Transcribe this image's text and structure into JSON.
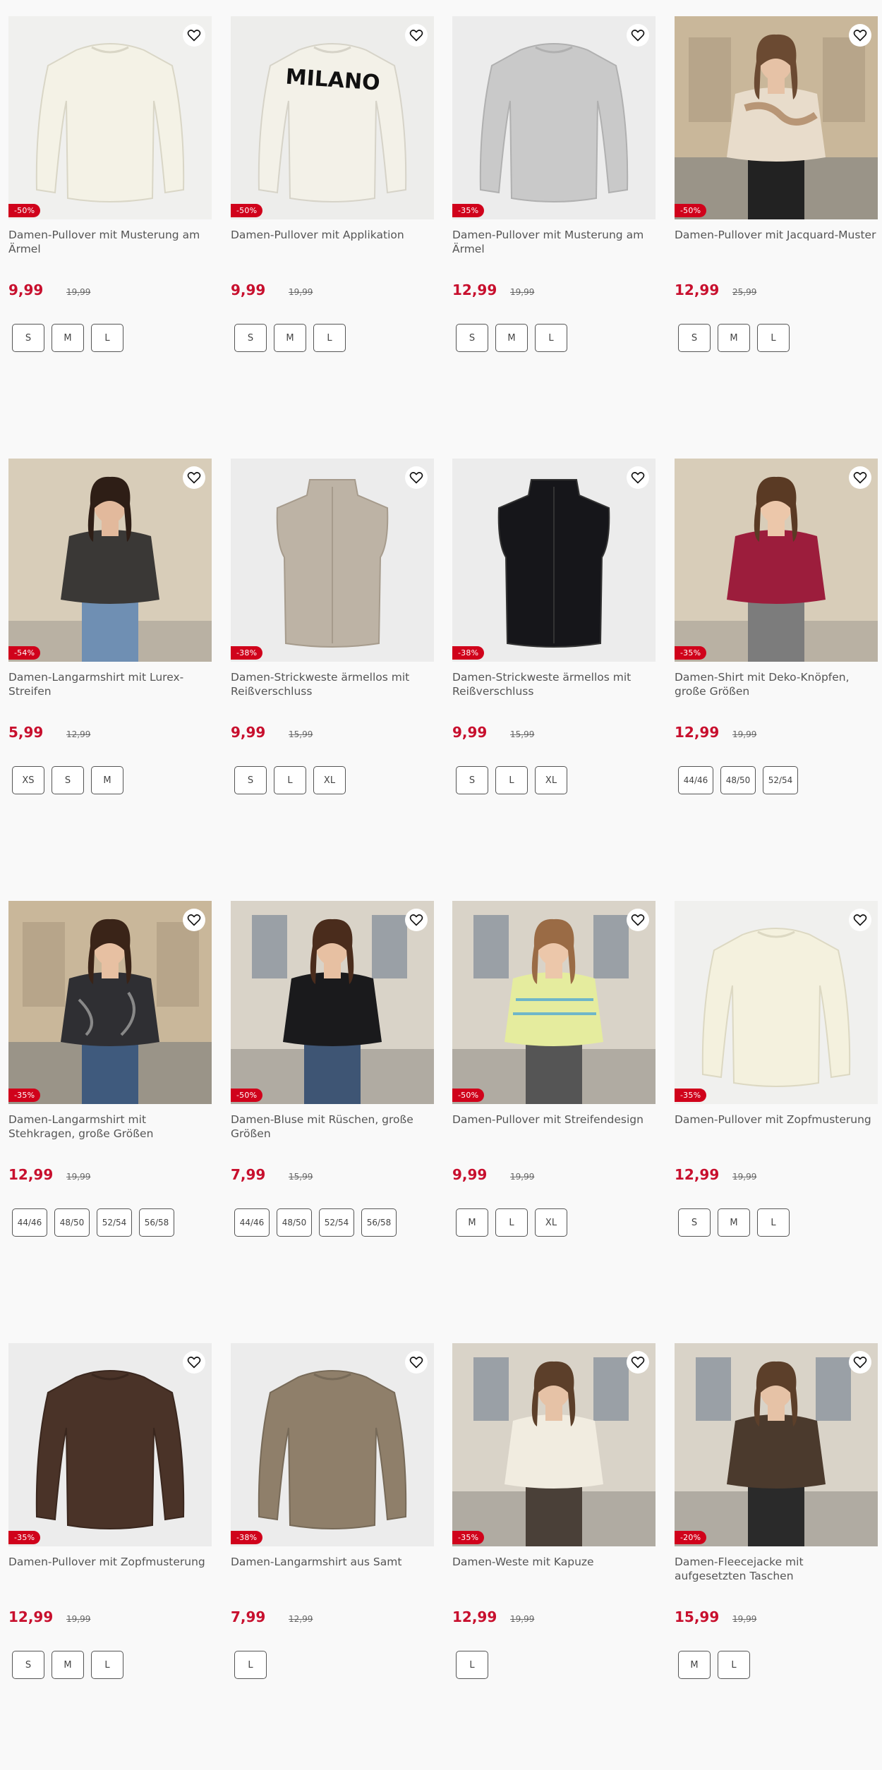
{
  "colors": {
    "price": "#c8102e",
    "badge": "#d0021b",
    "page_bg": "#f9f9f9",
    "image_bg": "#ececec"
  },
  "wishlist_icon": "heart-icon",
  "products": [
    {
      "title": "Damen-Pullover mit Musterung am Ärmel",
      "discount": "-50%",
      "price": "9,99",
      "old_price": "19,99",
      "sizes": [
        "S",
        "M",
        "L"
      ],
      "image": "cream-cable-knit-pullover"
    },
    {
      "title": "Damen-Pullover mit Applikation",
      "discount": "-50%",
      "price": "9,99",
      "old_price": "19,99",
      "sizes": [
        "S",
        "M",
        "L"
      ],
      "image": "white-pullover-milano",
      "image_text": "MILANO"
    },
    {
      "title": "Damen-Pullover mit Musterung am Ärmel",
      "discount": "-35%",
      "price": "12,99",
      "old_price": "19,99",
      "sizes": [
        "S",
        "M",
        "L"
      ],
      "image": "grey-knit-pullover"
    },
    {
      "title": "Damen-Pullover mit Jacquard-Muster",
      "discount": "-50%",
      "price": "12,99",
      "old_price": "25,99",
      "sizes": [
        "S",
        "M",
        "L"
      ],
      "image": "model-beige-jacquard-pullover"
    },
    {
      "title": "Damen-Langarmshirt mit Lurex-Streifen",
      "discount": "-54%",
      "price": "5,99",
      "old_price": "12,99",
      "sizes": [
        "XS",
        "S",
        "M"
      ],
      "image": "model-black-cropped-shirt"
    },
    {
      "title": "Damen-Strickweste ärmellos mit Reißverschluss",
      "discount": "-38%",
      "price": "9,99",
      "old_price": "15,99",
      "sizes": [
        "S",
        "L",
        "XL"
      ],
      "image": "taupe-knit-vest"
    },
    {
      "title": "Damen-Strickweste ärmellos mit Reißverschluss",
      "discount": "-38%",
      "price": "9,99",
      "old_price": "15,99",
      "sizes": [
        "S",
        "L",
        "XL"
      ],
      "image": "black-knit-vest"
    },
    {
      "title": "Damen-Shirt mit Deko-Knöpfen, große Größen",
      "discount": "-35%",
      "price": "12,99",
      "old_price": "19,99",
      "sizes": [
        "44/46",
        "48/50",
        "52/54"
      ],
      "image": "model-burgundy-shirt"
    },
    {
      "title": "Damen-Langarmshirt mit Stehkragen, große Größen",
      "discount": "-35%",
      "price": "12,99",
      "old_price": "19,99",
      "sizes": [
        "44/46",
        "48/50",
        "52/54",
        "56/58"
      ],
      "image": "model-black-print-tunic"
    },
    {
      "title": "Damen-Bluse mit Rüschen, große Größen",
      "discount": "-50%",
      "price": "7,99",
      "old_price": "15,99",
      "sizes": [
        "44/46",
        "48/50",
        "52/54",
        "56/58"
      ],
      "image": "model-black-blouse"
    },
    {
      "title": "Damen-Pullover mit Streifendesign",
      "discount": "-50%",
      "price": "9,99",
      "old_price": "19,99",
      "sizes": [
        "M",
        "L",
        "XL"
      ],
      "image": "model-yellow-striped-pullover"
    },
    {
      "title": "Damen-Pullover mit Zopfmusterung",
      "discount": "-35%",
      "price": "12,99",
      "old_price": "19,99",
      "sizes": [
        "S",
        "M",
        "L"
      ],
      "image": "cream-cable-pullover"
    },
    {
      "title": "Damen-Pullover mit Zopfmusterung",
      "discount": "-35%",
      "price": "12,99",
      "old_price": "19,99",
      "sizes": [
        "S",
        "M",
        "L"
      ],
      "image": "brown-cable-pullover"
    },
    {
      "title": "Damen-Langarmshirt aus Samt",
      "discount": "-38%",
      "price": "7,99",
      "old_price": "12,99",
      "sizes": [
        "L"
      ],
      "image": "taupe-velvet-shirt"
    },
    {
      "title": "Damen-Weste mit Kapuze",
      "discount": "-35%",
      "price": "12,99",
      "old_price": "19,99",
      "sizes": [
        "L"
      ],
      "image": "model-cream-teddy-vest"
    },
    {
      "title": "Damen-Fleecejacke mit aufgesetzten Taschen",
      "discount": "-20%",
      "price": "15,99",
      "old_price": "19,99",
      "sizes": [
        "M",
        "L"
      ],
      "image": "model-brown-fleece-jacket"
    }
  ]
}
